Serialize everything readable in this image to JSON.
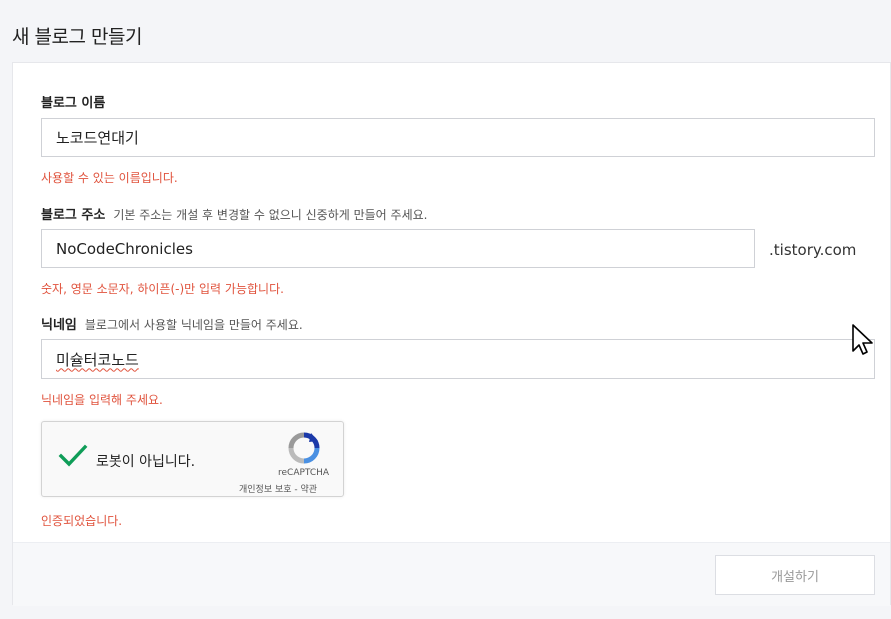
{
  "page": {
    "title": "새 블로그 만들기"
  },
  "form": {
    "blog_name": {
      "label": "블로그 이름",
      "value": "노코드연대기",
      "message": "사용할 수 있는 이름입니다."
    },
    "blog_address": {
      "label": "블로그 주소",
      "hint": "기본 주소는 개설 후 변경할 수 없으니 신중하게 만들어 주세요.",
      "value": "NoCodeChronicles",
      "suffix": ".tistory.com",
      "message": "숫자, 영문 소문자, 하이픈(-)만 입력 가능합니다."
    },
    "nickname": {
      "label": "닉네임",
      "hint": "블로그에서 사용할 닉네임을 만들어 주세요.",
      "value": "미슐터코노드",
      "message": "닉네임을 입력해 주세요."
    },
    "captcha": {
      "checkbox_label": "로봇이 아닙니다.",
      "brand": "reCAPTCHA",
      "links": "개인정보 보호 - 약관",
      "checked": true,
      "message": "인증되었습니다."
    }
  },
  "footer": {
    "submit_label": "개설하기"
  },
  "colors": {
    "error_text": "#e0533d",
    "check_green": "#0f9d58",
    "recaptcha_blue": "#1c3aa9"
  },
  "icons": [
    "checkmark-icon",
    "recaptcha-logo-icon",
    "mouse-cursor-icon"
  ]
}
